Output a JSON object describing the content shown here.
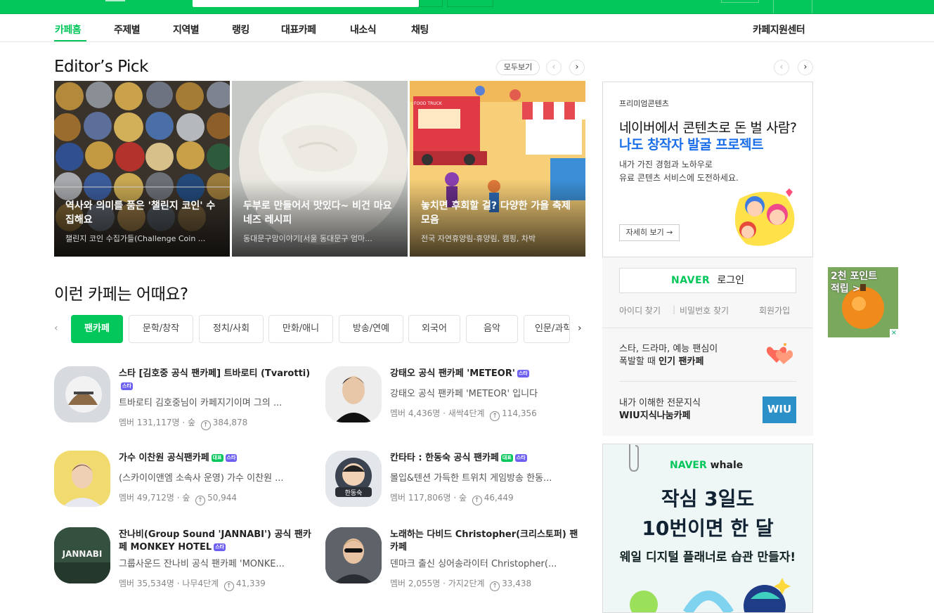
{
  "gnb": {
    "items": [
      "카페홈",
      "주제별",
      "지역별",
      "랭킹",
      "대표카페",
      "내소식",
      "채팅"
    ],
    "right": "카페지원센터"
  },
  "editors_pick": {
    "title": "Editor’s Pick",
    "more": "모두보기",
    "prev": "‹",
    "next": "›",
    "cards": [
      {
        "title": "역사와 의미를 품은 '챌린지 코인' 수집해요",
        "sub": "챌린지 코인 수집가들(Challenge Coin ..."
      },
      {
        "title": "두부로 만들어서 맛있다~ 비건 마요네즈 레시피",
        "sub": "동대문구맘이야기[서울 동대문구 엄마..."
      },
      {
        "title": "놓치면 후회할 걸? 다양한 가을 축제 모음",
        "sub": "전국 자연휴양림-휴양림, 캠핑, 차박"
      }
    ]
  },
  "recommend": {
    "title": "이런 카페는 어때요?",
    "chips": [
      "팬카페",
      "문학/창작",
      "정치/사회",
      "만화/애니",
      "방송/연예",
      "외국어",
      "음악",
      "인문/과학"
    ],
    "left_arrow": "‹",
    "right_arrow": "›",
    "badges": {
      "star": "스타",
      "rep": "대표"
    },
    "cafes": [
      {
        "name": "스타 [김호중 공식 팬카페] 트바로티 (Tvarotti)",
        "desc": "트바로티 김호중님이 카페지기이며 그의 ...",
        "meta_left": "멤버 131,117명 · 숲",
        "meta_score": "384,878"
      },
      {
        "name": "강태오 공식 팬카페 'METEOR'",
        "desc": "강태오 공식 팬카페 'METEOR' 입니다",
        "meta_left": "멤버 4,436명 · 새싹4단계",
        "meta_score": "114,356"
      },
      {
        "name": "가수 이찬원 공식팬카페",
        "desc": "(스카이이앤엠 소속사 운영) 가수 이찬원 ...",
        "meta_left": "멤버 49,712명 · 숲",
        "meta_score": "50,944"
      },
      {
        "name": "칸타타 : 한동숙 공식 팬카페",
        "desc": "몰입&텐션 가득한 트위치 게임방송 한동...",
        "meta_left": "멤버 117,806명 · 숲",
        "meta_score": "46,449"
      },
      {
        "name": "잔나비(Group Sound 'JANNABI') 공식 팬카페 MONKEY HOTEL",
        "desc": "그룹사운드 잔나비 공식 팬카페 'MONKE...",
        "meta_left": "멤버 35,534명 · 나무4단계",
        "meta_score": "41,339"
      },
      {
        "name": "노래하는 다비드 Christopher(크리스토퍼) 팬카페",
        "desc": "덴마크 출신 싱어송라이터 Christopher(...",
        "meta_left": "멤버 2,055명 · 가지2단계",
        "meta_score": "33,438"
      }
    ]
  },
  "promo": {
    "tag": "프리미엄콘텐츠",
    "h1": "네이버에서 콘텐츠로 돈 벌 사람?",
    "h2": "나도 창작자 발굴 프로젝트",
    "d1": "내가 가진 경험과 노하우로",
    "d2": "유료 콘텐츠 서비스에 도전하세요.",
    "detail": "자세히 보기 →"
  },
  "login": {
    "naver": "NAVER",
    "label": "로그인",
    "find_id": "아이디 찾기",
    "find_pw": "비밀번호 찾기",
    "join": "회원가입",
    "promo1_a": "스타, 드라마, 예능 팬심이",
    "promo1_b_pre": "폭발할 때 ",
    "promo1_b_bold": "인기 팬카페",
    "promo2_a": "내가 이해한 전문지식",
    "promo2_b": "WIU지식나눔카페",
    "wiu": "WIU"
  },
  "ad_small": {
    "line1": "2천 포인트",
    "line2": "적립 >"
  },
  "whale_ad": {
    "logo_naver": "NAVER",
    "logo_whale": "whale",
    "line1": "작심 3일도",
    "line2": "10번이면 한 달",
    "line3": "웨일 디지털 플래너로 습관 만들자!"
  },
  "colors": {
    "brand": "#03c75a",
    "link_blue": "#1a6ee8",
    "star_badge": "#6d5ff0"
  }
}
